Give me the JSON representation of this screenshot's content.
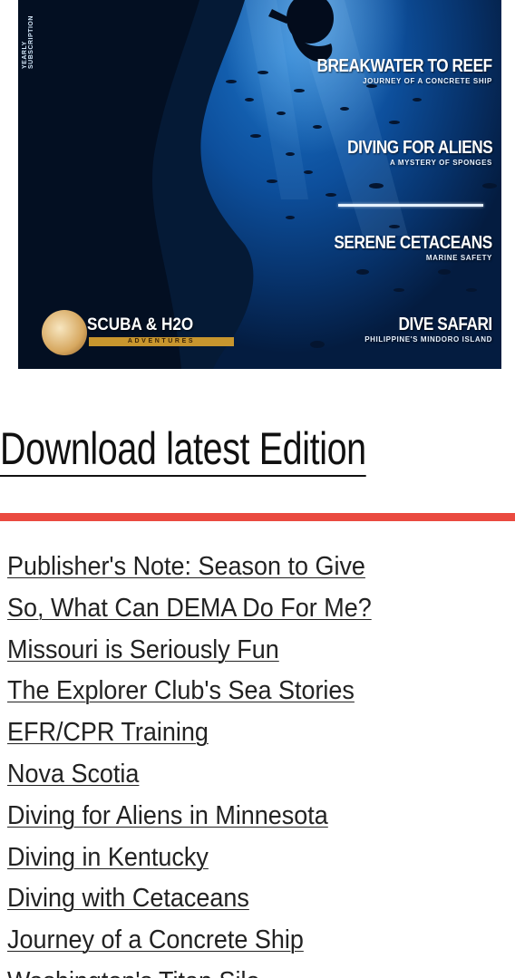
{
  "cover": {
    "spine_text": "YEARLY SUBSCRIPTION",
    "stories": [
      {
        "headline": "BREAKWATER TO REEF",
        "sub": "JOURNEY OF A CONCRETE SHIP"
      },
      {
        "headline": "DIVING FOR ALIENS",
        "sub": "A MYSTERY OF SPONGES"
      },
      {
        "headline": "SERENE CETACEANS",
        "sub": "MARINE SAFETY"
      },
      {
        "headline": "DIVE SAFARI",
        "sub": "PHILIPPINE'S MINDORO ISLAND"
      }
    ],
    "logo": {
      "name": "SCUBA & H2O",
      "tagline": "ADVENTURES"
    }
  },
  "download": {
    "label": "Download latest Edition"
  },
  "articles": [
    "Publisher's Note: Season to Give",
    "So, What Can DEMA Do For Me?",
    "Missouri is Seriously Fun",
    "The Explorer Club's Sea Stories",
    "EFR/CPR Training",
    "Nova Scotia",
    "Diving for Aliens in Minnesota",
    "Diving in Kentucky",
    "Diving with Cetaceans",
    "Journey of a Concrete Ship",
    "Washington's Titan Silo"
  ],
  "colors": {
    "accent_rule": "#ea4a40",
    "link_text": "#222222",
    "cover_blue": "#0d4f9c"
  }
}
